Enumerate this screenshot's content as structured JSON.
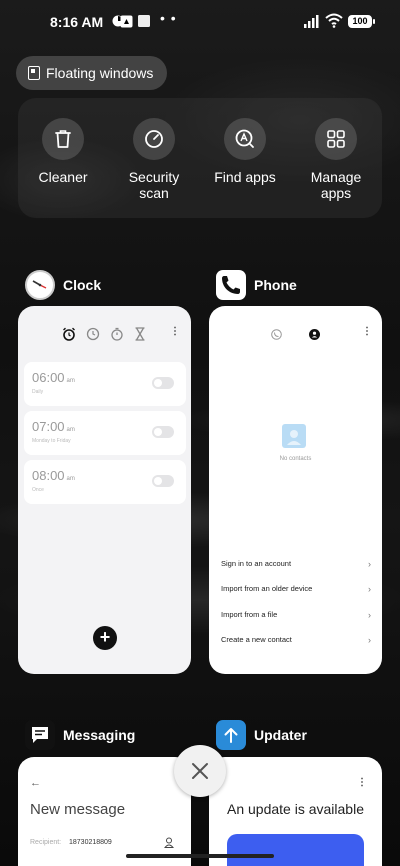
{
  "status": {
    "time": "8:16 AM",
    "battery": "100",
    "dots": "• •"
  },
  "floating_windows": {
    "label": "Floating windows"
  },
  "quick_actions": [
    {
      "label": "Cleaner",
      "icon": "trash-icon"
    },
    {
      "label": "Security scan",
      "icon": "security-scan-icon"
    },
    {
      "label": "Find apps",
      "icon": "find-apps-icon"
    },
    {
      "label": "Manage apps",
      "icon": "manage-apps-icon"
    }
  ],
  "apps": {
    "clock": {
      "name": "Clock",
      "alarms": [
        {
          "time": "06:00",
          "ampm": "am",
          "sub": "Daily"
        },
        {
          "time": "07:00",
          "ampm": "am",
          "sub": "Monday to Friday"
        },
        {
          "time": "08:00",
          "ampm": "am",
          "sub": "Once"
        }
      ]
    },
    "phone": {
      "name": "Phone",
      "empty_text": "No contacts",
      "options": [
        "Sign in to an account",
        "Import from an older device",
        "Import from a file",
        "Create a new contact"
      ]
    },
    "messaging": {
      "name": "Messaging",
      "title": "New message",
      "recipient_label": "Recipient:",
      "recipient_value": "18730218809"
    },
    "updater": {
      "name": "Updater",
      "title": "An update is available"
    }
  },
  "colors": {
    "updater_blue": "#2a8bd8",
    "update_card_blue": "#3d5ef0"
  }
}
